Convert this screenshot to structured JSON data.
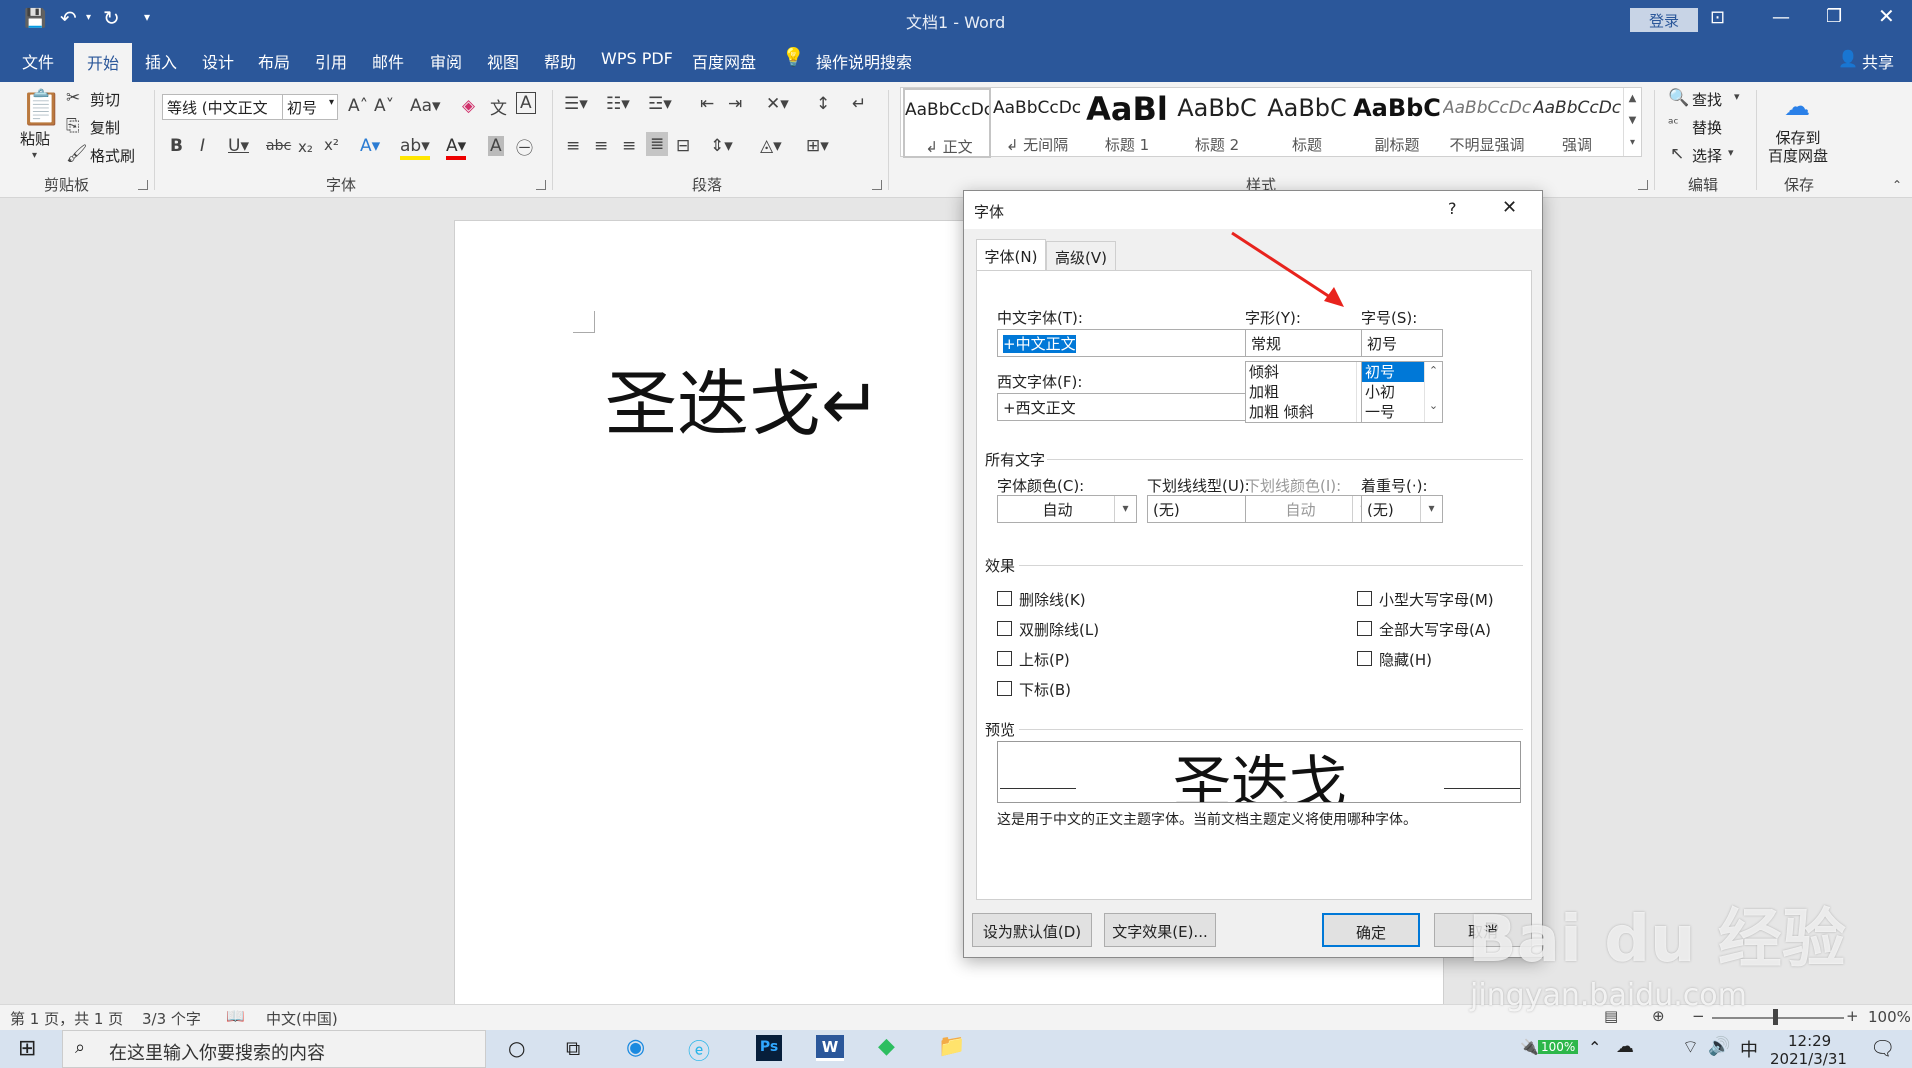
{
  "title_bar": {
    "doc_title": "文档1 - Word",
    "login_label": "登录"
  },
  "menu": {
    "items": [
      "文件",
      "开始",
      "插入",
      "设计",
      "布局",
      "引用",
      "邮件",
      "审阅",
      "视图",
      "帮助",
      "WPS PDF",
      "百度网盘"
    ],
    "search_label": "操作说明搜索",
    "share_label": "共享"
  },
  "ribbon": {
    "clipboard": {
      "paste": "粘贴",
      "cut": "剪切",
      "copy": "复制",
      "format_painter": "格式刷",
      "label": "剪贴板"
    },
    "font": {
      "font_name": "等线 (中文正文",
      "font_size": "初号",
      "label": "字体"
    },
    "paragraph": {
      "label": "段落"
    },
    "styles": {
      "label": "样式",
      "items": [
        {
          "sample": "AaBbCcDc",
          "name": "↲ 正文"
        },
        {
          "sample": "AaBbCcDc",
          "name": "↲ 无间隔"
        },
        {
          "sample": "AaBl",
          "name": "标题 1"
        },
        {
          "sample": "AaBbC",
          "name": "标题 2"
        },
        {
          "sample": "AaBbC",
          "name": "标题"
        },
        {
          "sample": "AaBbC",
          "name": "副标题"
        },
        {
          "sample": "AaBbCcDc",
          "name": "不明显强调"
        },
        {
          "sample": "AaBbCcDc",
          "name": "强调"
        }
      ]
    },
    "editing": {
      "find": "查找",
      "replace": "替换",
      "select": "选择",
      "label": "编辑"
    },
    "save": {
      "button": "保存到\n百度网盘",
      "label": "保存"
    }
  },
  "document": {
    "text": "圣迭戈↵"
  },
  "dialog": {
    "title": "字体",
    "help": "?",
    "tabs": [
      "字体(N)",
      "高级(V)"
    ],
    "cn_font_label": "中文字体(T):",
    "cn_font_value": "+中文正文",
    "west_font_label": "西文字体(F):",
    "west_font_value": "+西文正文",
    "style_label": "字形(Y):",
    "style_value": "常规",
    "style_options": [
      "倾斜",
      "加粗",
      "加粗 倾斜"
    ],
    "size_label": "字号(S):",
    "size_value": "初号",
    "size_options": [
      "初号",
      "小初",
      "一号"
    ],
    "all_text_label": "所有文字",
    "color_label": "字体颜色(C):",
    "color_value": "自动",
    "underline_label": "下划线线型(U):",
    "underline_value": "(无)",
    "underline_color_label": "下划线颜色(I):",
    "underline_color_value": "自动",
    "emphasis_label": "着重号(·):",
    "emphasis_value": "(无)",
    "effects_label": "效果",
    "effects_left": [
      "删除线(K)",
      "双删除线(L)",
      "上标(P)",
      "下标(B)"
    ],
    "effects_right": [
      "小型大写字母(M)",
      "全部大写字母(A)",
      "隐藏(H)"
    ],
    "preview_label": "预览",
    "preview_text": "圣迭戈",
    "preview_note": "这是用于中文的正文主题字体。当前文档主题定义将使用哪种字体。",
    "btn_default": "设为默认值(D)",
    "btn_effects": "文字效果(E)...",
    "btn_ok": "确定",
    "btn_cancel": "取消"
  },
  "status_bar": {
    "page": "第 1 页，共 1 页",
    "words": "3/3 个字",
    "lang": "中文(中国)",
    "zoom": "100%"
  },
  "taskbar": {
    "search_placeholder": "在这里输入你要搜索的内容",
    "time": "12:29",
    "date": "2021/3/31",
    "battery": "100%",
    "ime": "中"
  },
  "watermark": {
    "brand": "Bai du 经验",
    "url": "jingyan.baidu.com"
  }
}
